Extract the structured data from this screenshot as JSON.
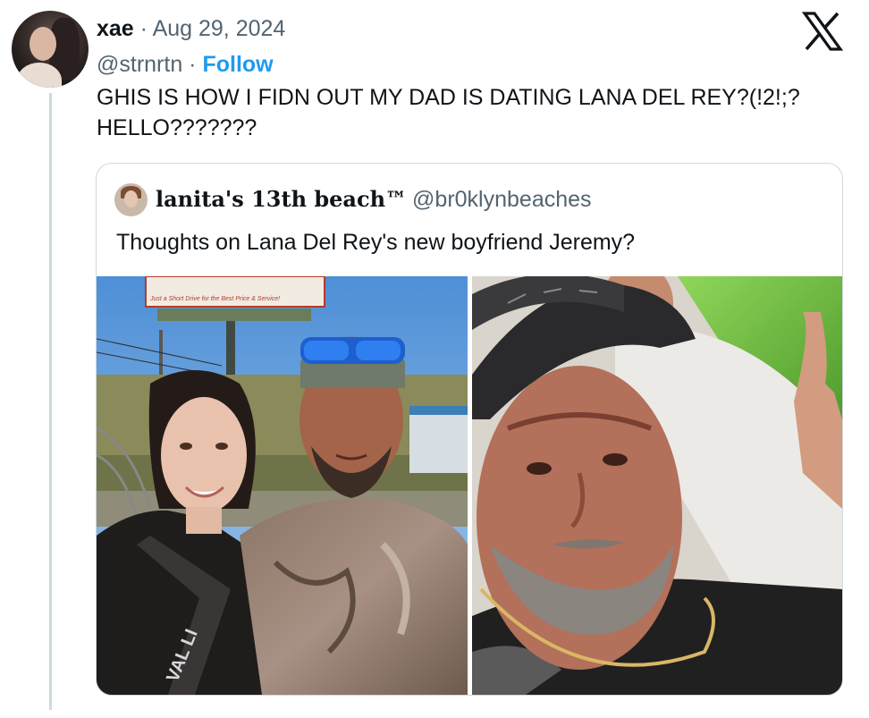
{
  "tweet": {
    "author_name": "xae",
    "separator": " · ",
    "date": "Aug 29, 2024",
    "handle": "@strnrtn",
    "follow_label": "Follow",
    "text": "GHIS IS HOW I FIDN OUT MY DAD IS DATING LANA DEL REY?(!2!;?\nHELLO???????"
  },
  "quoted_tweet": {
    "author_name": "lanita's 13th beach™",
    "handle": "@br0klynbeaches",
    "text": "Thoughts on Lana Del Rey's new boyfriend Jeremy?"
  },
  "photo1_sign_text": "Just a Short Drive for the Best Price & Service!",
  "photo1_shirt_text": "VAL LI",
  "icons": {
    "brand": "x-logo-icon"
  },
  "colors": {
    "link_blue": "#1d9bf0",
    "secondary_text": "#536471",
    "border": "#cfd9de"
  }
}
